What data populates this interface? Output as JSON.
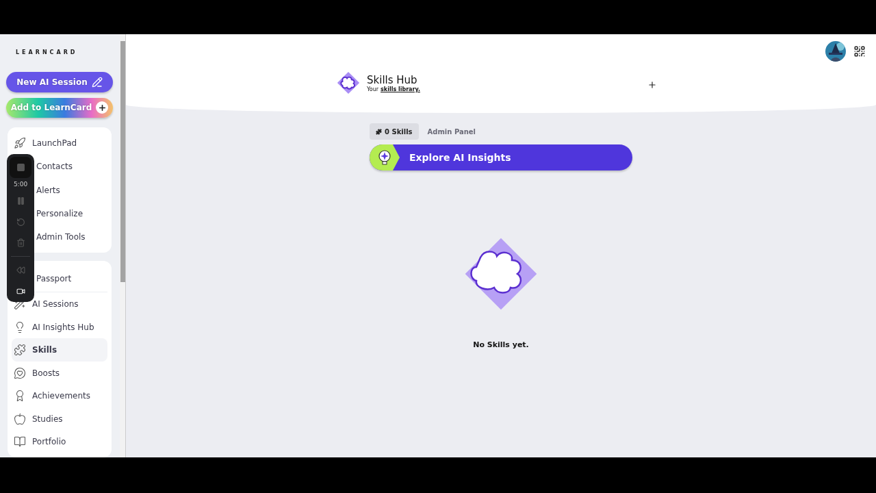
{
  "sidebar": {
    "logo": "LEARNCARD",
    "new_session_button": "New AI Session",
    "add_button": "Add to LearnCard",
    "groups": [
      {
        "items": [
          {
            "label": "LaunchPad",
            "selected": false
          },
          {
            "label": "Contacts",
            "selected": false
          },
          {
            "label": "Alerts",
            "selected": false
          },
          {
            "label": "Personalize",
            "selected": false
          },
          {
            "label": "Admin Tools",
            "selected": false
          }
        ]
      },
      {
        "items": [
          {
            "label": "Passport",
            "selected": false
          },
          {
            "label": "AI Sessions",
            "selected": false
          },
          {
            "label": "AI Insights Hub",
            "selected": false
          },
          {
            "label": "Skills",
            "selected": true
          },
          {
            "label": "Boosts",
            "selected": false
          },
          {
            "label": "Achievements",
            "selected": false
          },
          {
            "label": "Studies",
            "selected": false
          },
          {
            "label": "Portfolio",
            "selected": false
          }
        ]
      }
    ]
  },
  "recorder": [
    {
      "kind": "stop"
    },
    {
      "kind": "timer",
      "text": "5:00"
    },
    {
      "kind": "pause"
    },
    {
      "kind": "restart"
    },
    {
      "kind": "delete"
    },
    {
      "kind": "divider"
    },
    {
      "kind": "rewind"
    },
    {
      "kind": "camera"
    }
  ],
  "header": {
    "title": "Skills Hub",
    "subtitle": "Your",
    "subtitle_link": "skills library."
  },
  "tabs": [
    {
      "label": "0 Skills",
      "selected": true
    },
    {
      "label": "Admin Panel",
      "selected": false
    }
  ],
  "banner": {
    "label": "Explore AI Insights"
  },
  "empty_state": {
    "message": "No Skills yet."
  }
}
